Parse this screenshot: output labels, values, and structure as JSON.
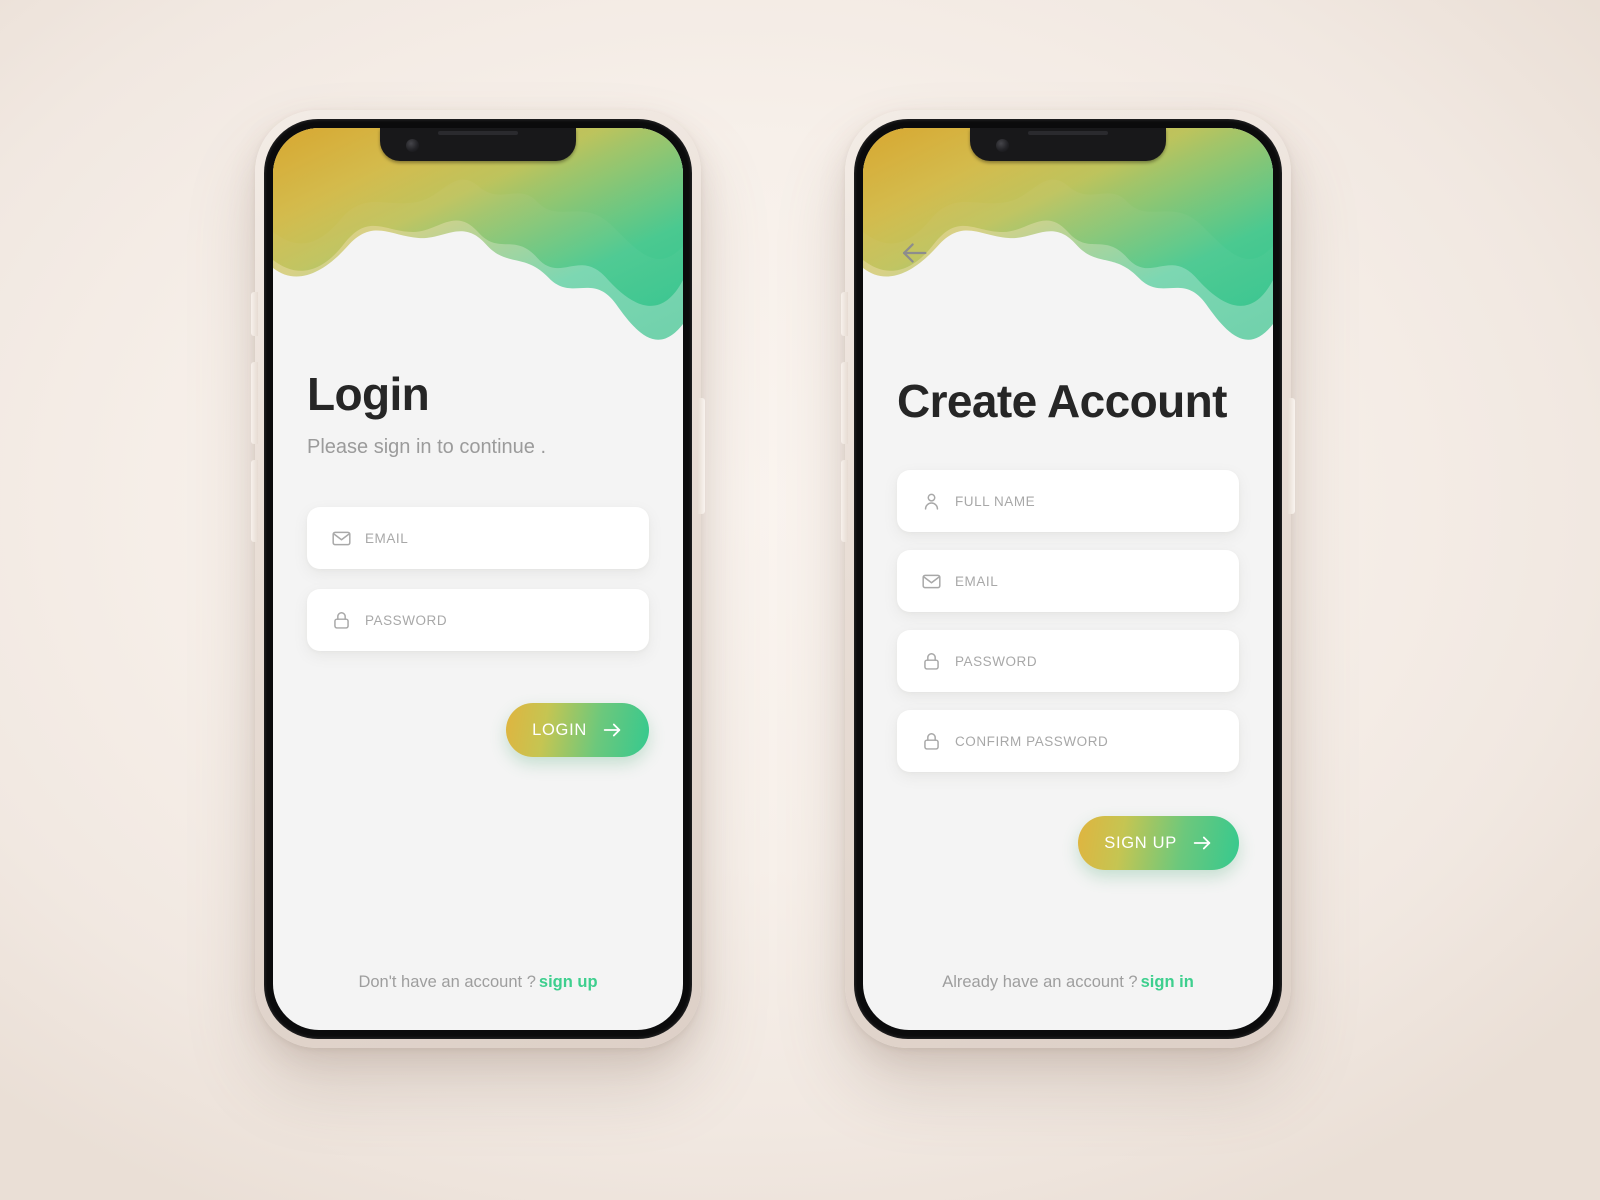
{
  "colors": {
    "canvas_background": "#f7f0ea",
    "screen_background": "#f4f4f4",
    "accent_green": "#3ecf8e",
    "accent_yellow": "#e0b43f",
    "blob_mint": "#a8dfbc",
    "blob_green": "#3fc68a",
    "title_text": "#262626",
    "muted_text": "#9b9b9b",
    "placeholder_text": "#a8a8a8",
    "card_white": "#ffffff",
    "bezel_black": "#0b0b0c",
    "frame_cream": "#e9ded6"
  },
  "screens": [
    {
      "id": "login",
      "device_label": "phone-login",
      "has_back_button": false,
      "back_icon": "arrow-left-icon",
      "title": "Login",
      "subtitle": "Please sign in to continue .",
      "fields": [
        {
          "name": "email",
          "icon": "envelope-icon",
          "label": "EMAIL",
          "value": "",
          "placeholder": "EMAIL"
        },
        {
          "name": "password",
          "icon": "lock-icon",
          "label": "PASSWORD",
          "value": "",
          "placeholder": "PASSWORD"
        }
      ],
      "cta": {
        "label": "LOGIN",
        "icon": "arrow-right-icon"
      },
      "footer": {
        "text": "Don't have an account ?",
        "link": "sign up"
      }
    },
    {
      "id": "create-account",
      "device_label": "phone-create-account",
      "has_back_button": true,
      "back_icon": "arrow-left-icon",
      "title": "Create Account",
      "subtitle": "",
      "fields": [
        {
          "name": "full-name",
          "icon": "person-icon",
          "label": "FULL NAME",
          "value": "",
          "placeholder": "FULL NAME"
        },
        {
          "name": "email",
          "icon": "envelope-icon",
          "label": "EMAIL",
          "value": "",
          "placeholder": "EMAIL"
        },
        {
          "name": "password",
          "icon": "lock-icon",
          "label": "PASSWORD",
          "value": "",
          "placeholder": "PASSWORD"
        },
        {
          "name": "confirm-password",
          "icon": "lock-icon",
          "label": "CONFIRM PASSWORD",
          "value": "",
          "placeholder": "CONFIRM PASSWORD"
        }
      ],
      "cta": {
        "label": "SIGN UP",
        "icon": "arrow-right-icon"
      },
      "footer": {
        "text": "Already have an account ?",
        "link": "sign in"
      }
    }
  ],
  "hardware": {
    "notch_camera": "front-camera",
    "notch_speaker": "earpiece-speaker",
    "buttons": [
      "mute-switch",
      "volume-up-button",
      "volume-down-button",
      "power-button"
    ]
  }
}
